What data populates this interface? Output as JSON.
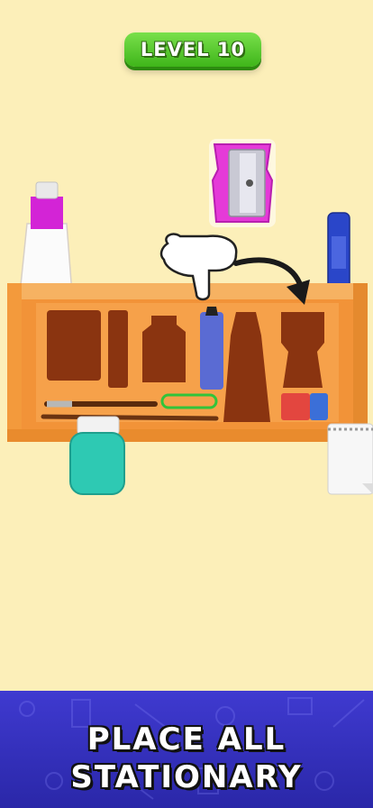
{
  "hud": {
    "level_label": "LEVEL 10"
  },
  "banner": {
    "line1": "PLACE ALL",
    "line2": "STATIONARY"
  },
  "items": {
    "sharpener": "pencil-sharpener",
    "glue_tube": "glue-tube",
    "marker": "marker-pen",
    "paint_jar": "paint-jar",
    "notepad": "notepad"
  },
  "colors": {
    "background": "#fcefb9",
    "box_orange": "#f39a3c",
    "slot_brown": "#8a3410",
    "level_green": "#4cc023",
    "banner_blue": "#3431c0",
    "sharpener_magenta": "#e53ad8",
    "jar_teal": "#2ec9b3"
  }
}
